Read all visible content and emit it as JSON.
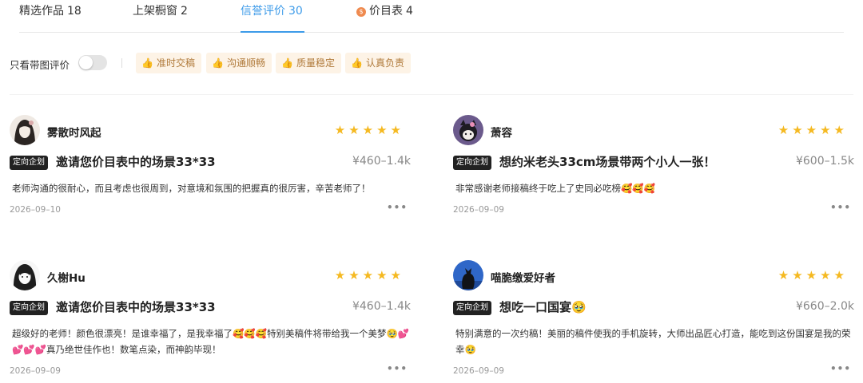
{
  "tabs": [
    {
      "label": "精选作品",
      "count": "18"
    },
    {
      "label": "上架橱窗",
      "count": "2"
    },
    {
      "label": "信誉评价",
      "count": "30"
    },
    {
      "label": "价目表",
      "count": "4",
      "icon": "coin-icon"
    }
  ],
  "active_tab": "信誉评价",
  "filter": {
    "toggle_label": "只看带图评价",
    "toggle_on": false,
    "chips": [
      "准时交稿",
      "沟通顺畅",
      "质量稳定",
      "认真负责"
    ]
  },
  "colors": {
    "accent": "#3d9be9",
    "star": "#f5b921",
    "chip_bg": "#fdf3e6",
    "chip_text": "#b07a3a"
  },
  "reviews": [
    {
      "username": "雾散时风起",
      "rating": 5,
      "tag": "定向企划",
      "title": "邀请您价目表中的场景33*33",
      "price": "¥460–1.4k",
      "comment": "老师沟通的很耐心，而且考虑也很周到，对意境和氛围的把握真的很厉害，辛苦老师了！",
      "date": "2026–09–10",
      "more": "•••"
    },
    {
      "username": "萧容",
      "rating": 5,
      "tag": "定向企划",
      "title": "想约米老头33cm场景带两个小人一张！",
      "price": "¥600–1.5k",
      "comment": "非常感谢老师接稿终于吃上了史同必吃榜🥰🥰🥰",
      "date": "2026–09–09",
      "more": "•••"
    },
    {
      "username": "久榭Hu",
      "rating": 5,
      "tag": "定向企划",
      "title": "邀请您价目表中的场景33*33",
      "price": "¥460–1.4k",
      "comment": "超级好的老师！颜色很漂亮！是谁幸福了，是我幸福了🥰🥰🥰特别美稿件将带给我一个美梦🥹💕💕💕💕真乃绝世佳作也！数笔点染，而神韵毕现！",
      "date": "2026–09–09",
      "more": "•••"
    },
    {
      "username": "喵脆缴爱好者",
      "rating": 5,
      "tag": "定向企划",
      "title": "想吃一口国宴🥹",
      "price": "¥660–2.0k",
      "comment": "特别满意的一次约稿！美丽的稿件使我的手机旋转，大师出品匠心打造，能吃到这份国宴是我的荣幸🥹",
      "date": "2026–09–09",
      "more": "•••"
    }
  ]
}
